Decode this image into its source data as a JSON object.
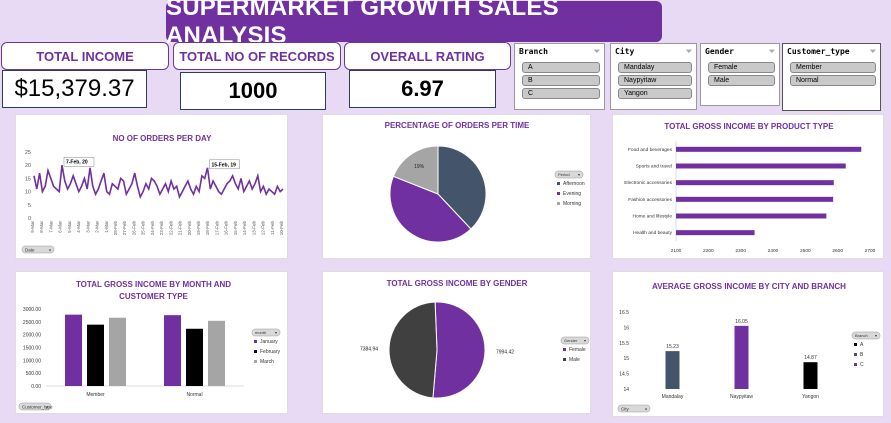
{
  "title": "SUPERMARKET GROWTH SALES ANALYSIS",
  "kpis": {
    "income_label": "TOTAL INCOME",
    "income_value": "$15,379.37",
    "records_label": "TOTAL NO OF RECORDS",
    "records_value": "1000",
    "rating_label": "OVERALL RATING",
    "rating_value": "6.97"
  },
  "slicers": {
    "branch": {
      "title": "Branch",
      "items": [
        "A",
        "B",
        "C"
      ]
    },
    "city": {
      "title": "City",
      "items": [
        "Mandalay",
        "Naypyitaw",
        "Yangon"
      ]
    },
    "gender": {
      "title": "Gender",
      "items": [
        "Female",
        "Male"
      ]
    },
    "customer_type": {
      "title": "Customer_type",
      "items": [
        "Member",
        "Normal"
      ]
    }
  },
  "colors": {
    "accent": "#7030a0",
    "slate": "#44546a",
    "gray": "#a5a5a5",
    "dark": "#404040",
    "black": "#000000"
  },
  "chart_data": [
    {
      "id": "orders_per_day",
      "type": "line",
      "title": "NO OF ORDERS PER DAY",
      "ylim": [
        0,
        25
      ],
      "yticks": [
        0,
        5,
        10,
        15,
        20,
        25
      ],
      "x_tick_labels": [
        "9-Mar",
        "8-Mar",
        "7-Mar",
        "6-Mar",
        "5-Mar",
        "4-Mar",
        "3-Mar",
        "2-Mar",
        "1-Mar",
        "28-Feb",
        "27-Feb",
        "26-Feb",
        "25-Feb",
        "24-Feb",
        "23-Feb",
        "22-Feb",
        "21-Feb",
        "20-Feb",
        "19-Feb",
        "18-Feb",
        "17-Feb",
        "16-Feb",
        "15-Feb",
        "14-Feb",
        "13-Feb",
        "12-Feb",
        "11-Feb",
        "10-Feb"
      ],
      "values": [
        16,
        11,
        17,
        10,
        12,
        18,
        15,
        12,
        11,
        10,
        20,
        14,
        11,
        13,
        16,
        13,
        10,
        12,
        15,
        11,
        19,
        12,
        9,
        11,
        14,
        17,
        10,
        9,
        13,
        12,
        11,
        15,
        14,
        9,
        11,
        13,
        17,
        12,
        8,
        10,
        13,
        11,
        15,
        14,
        12,
        9,
        11,
        13,
        10,
        14,
        11,
        12,
        8,
        10,
        12,
        14,
        11,
        9,
        12,
        10,
        16,
        15,
        19,
        11,
        14,
        12,
        10,
        9,
        11,
        13,
        14,
        16,
        13,
        11,
        15,
        10,
        12,
        14,
        11,
        13,
        16,
        10,
        12,
        9,
        11,
        10,
        9,
        12,
        10,
        11
      ],
      "annotations": [
        {
          "index": 10,
          "label": "7-Feb, 20"
        },
        {
          "index": 62,
          "label": "15-Feb, 19"
        }
      ],
      "filter_button": "Date"
    },
    {
      "id": "orders_per_time",
      "type": "pie",
      "title": "PERCENTAGE OF ORDERS PER TIME",
      "categories": [
        "Afternoon",
        "Evening",
        "Morning"
      ],
      "values": [
        38,
        43,
        19
      ],
      "data_labels": [
        "",
        "",
        "19%"
      ],
      "legend_title": "Period",
      "legend_position": "right"
    },
    {
      "id": "gross_by_product",
      "type": "bar",
      "orientation": "horizontal",
      "title": "TOTAL GROSS INCOME BY PRODUCT TYPE",
      "categories": [
        "Food and beverages",
        "Sports and travel",
        "Electronic accessories",
        "Fashion accessories",
        "Home and lifestyle",
        "Health and beauty"
      ],
      "values": [
        2673,
        2625,
        2588,
        2586,
        2565,
        2343
      ],
      "xlim": [
        2100,
        2700
      ],
      "xticks": [
        2100,
        2200,
        2300,
        2400,
        2500,
        2600,
        2700
      ]
    },
    {
      "id": "gross_by_month_customer",
      "type": "bar",
      "title": "TOTAL GROSS INCOME BY MONTH AND CUSTOMER TYPE",
      "categories": [
        "Member",
        "Normal"
      ],
      "series": [
        {
          "name": "January",
          "values": [
            2780,
            2760
          ]
        },
        {
          "name": "February",
          "values": [
            2390,
            2230
          ]
        },
        {
          "name": "March",
          "values": [
            2660,
            2540
          ]
        }
      ],
      "ylim": [
        0,
        3000
      ],
      "yticks": [
        "0.00",
        "500.00",
        "1000.00",
        "1500.00",
        "2000.00",
        "2500.00",
        "3000.00"
      ],
      "legend_title": "month",
      "filter_button": "Customer_type"
    },
    {
      "id": "gross_by_gender",
      "type": "pie",
      "title": "TOTAL GROSS INCOME BY GENDER",
      "categories": [
        "Female",
        "Male"
      ],
      "values": [
        7994.42,
        7384.94
      ],
      "data_labels": [
        "7994.42",
        "7384.94"
      ],
      "legend_title": "Gender",
      "legend_position": "right"
    },
    {
      "id": "avg_gross_city_branch",
      "type": "bar",
      "title": "AVERAGE GROSS INCOME BY CITY AND BRANCH",
      "categories": [
        "Mandalay",
        "Naypyitaw",
        "Yangon"
      ],
      "series": [
        {
          "name": "A",
          "values": [
            null,
            null,
            14.87
          ]
        },
        {
          "name": "B",
          "values": [
            15.23,
            null,
            null
          ]
        },
        {
          "name": "C",
          "values": [
            null,
            16.05,
            null
          ]
        }
      ],
      "data_labels": [
        "15.23",
        "16.05",
        "14.87"
      ],
      "ylim": [
        14,
        16.5
      ],
      "yticks": [
        "14",
        "14.5",
        "15",
        "15.5",
        "16",
        "16.5"
      ],
      "legend_title": "Branch",
      "filter_button": "City"
    }
  ]
}
